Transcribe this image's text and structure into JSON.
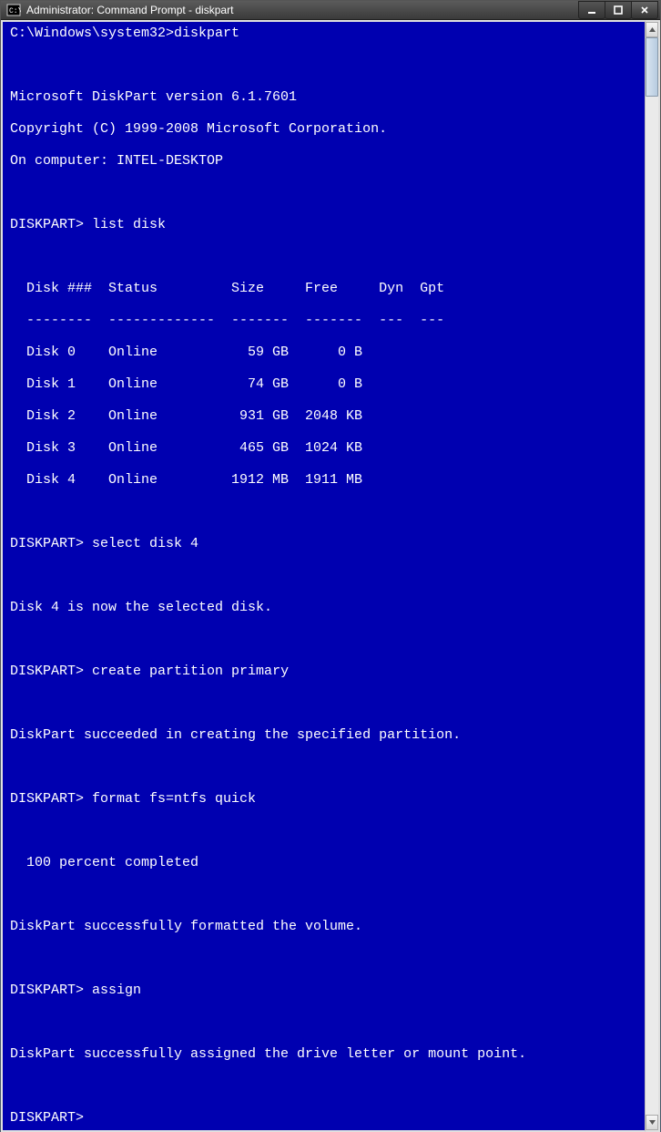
{
  "window": {
    "title": "Administrator: Command Prompt - diskpart"
  },
  "prompt_path": "C:\\Windows\\system32>",
  "cmd_diskpart": "diskpart",
  "version_line": "Microsoft DiskPart version 6.1.7601",
  "copyright_line": "Copyright (C) 1999-2008 Microsoft Corporation.",
  "computer_line": "On computer: INTEL-DESKTOP",
  "dp_prompt": "DISKPART>",
  "cmd_list": "list disk",
  "header": "  Disk ###  Status         Size     Free     Dyn  Gpt",
  "divider": "  --------  -------------  -------  -------  ---  ---",
  "rows": [
    "  Disk 0    Online           59 GB      0 B",
    "  Disk 1    Online           74 GB      0 B",
    "  Disk 2    Online          931 GB  2048 KB",
    "  Disk 3    Online          465 GB  1024 KB",
    "  Disk 4    Online         1912 MB  1911 MB"
  ],
  "cmd_select": "select disk 4",
  "msg_select": "Disk 4 is now the selected disk.",
  "cmd_create": "create partition primary",
  "msg_create": "DiskPart succeeded in creating the specified partition.",
  "cmd_format": "format fs=ntfs quick",
  "msg_progress": "  100 percent completed",
  "msg_format": "DiskPart successfully formatted the volume.",
  "cmd_assign": "assign",
  "msg_assign": "DiskPart successfully assigned the drive letter or mount point.",
  "chart_data": {
    "type": "table",
    "title": "list disk",
    "columns": [
      "Disk ###",
      "Status",
      "Size",
      "Free",
      "Dyn",
      "Gpt"
    ],
    "rows": [
      {
        "disk": "Disk 0",
        "status": "Online",
        "size": "59 GB",
        "free": "0 B",
        "dyn": "",
        "gpt": ""
      },
      {
        "disk": "Disk 1",
        "status": "Online",
        "size": "74 GB",
        "free": "0 B",
        "dyn": "",
        "gpt": ""
      },
      {
        "disk": "Disk 2",
        "status": "Online",
        "size": "931 GB",
        "free": "2048 KB",
        "dyn": "",
        "gpt": ""
      },
      {
        "disk": "Disk 3",
        "status": "Online",
        "size": "465 GB",
        "free": "1024 KB",
        "dyn": "",
        "gpt": ""
      },
      {
        "disk": "Disk 4",
        "status": "Online",
        "size": "1912 MB",
        "free": "1911 MB",
        "dyn": "",
        "gpt": ""
      }
    ]
  }
}
